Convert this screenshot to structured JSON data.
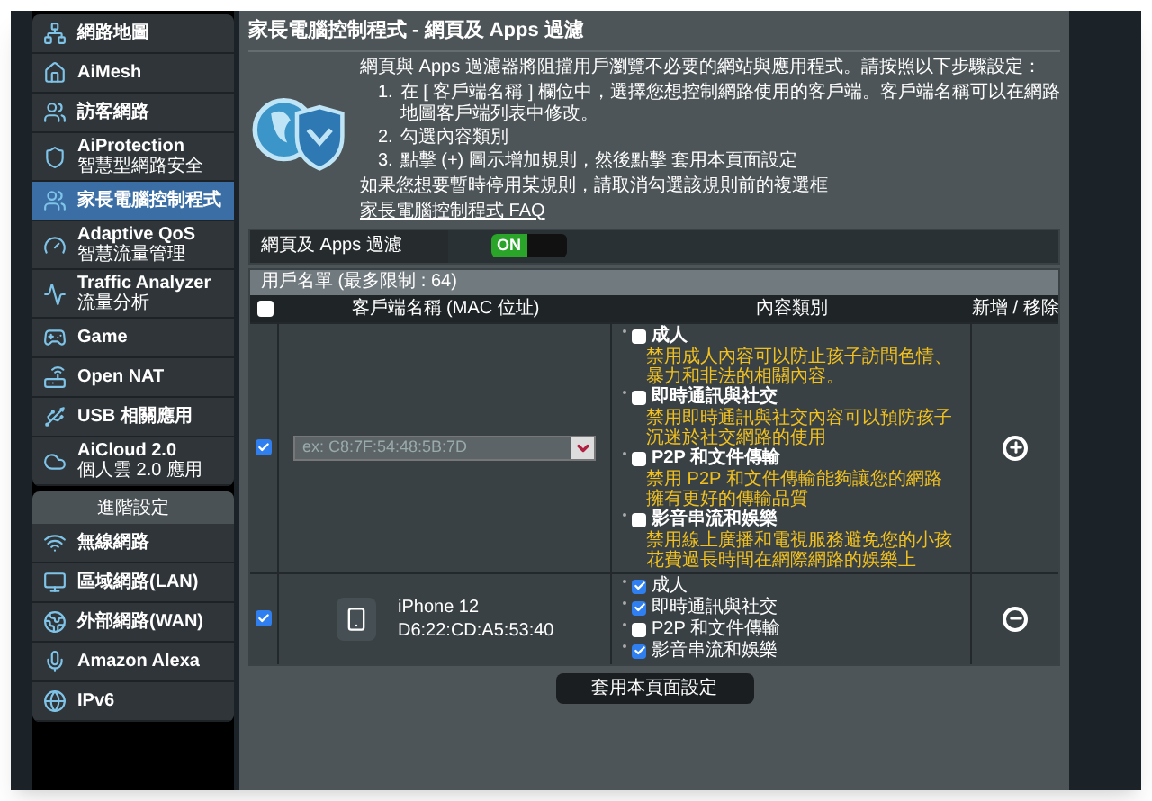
{
  "sidebar": {
    "items": [
      {
        "title": "網路地圖",
        "selected": false
      },
      {
        "title": "AiMesh",
        "selected": false
      },
      {
        "title": "訪客網路",
        "selected": false
      },
      {
        "title": "AiProtection",
        "subtitle": "智慧型網路安全",
        "selected": false
      },
      {
        "title": "家長電腦控制程式",
        "selected": true
      },
      {
        "title": "Adaptive QoS",
        "subtitle": "智慧流量管理",
        "selected": false
      },
      {
        "title": "Traffic Analyzer",
        "subtitle": "流量分析",
        "selected": false
      },
      {
        "title": "Game",
        "selected": false
      },
      {
        "title": "Open NAT",
        "selected": false
      },
      {
        "title": "USB 相關應用",
        "selected": false
      },
      {
        "title": "AiCloud 2.0",
        "subtitle": "個人雲 2.0 應用",
        "selected": false
      }
    ],
    "section_title": "進階設定",
    "advanced_items": [
      {
        "title": "無線網路",
        "selected": false
      },
      {
        "title": "區域網路(LAN)",
        "selected": false
      },
      {
        "title": "外部網路(WAN)",
        "selected": false
      },
      {
        "title": "Amazon Alexa",
        "selected": false
      },
      {
        "title": "IPv6",
        "selected": false
      }
    ]
  },
  "page": {
    "title": "家長電腦控制程式 - 網頁及 Apps 過濾",
    "intro": "網頁與 Apps 過濾器將阻擋用戶瀏覽不必要的網站與應用程式。請按照以下步驟設定：",
    "steps": [
      {
        "number": "1.",
        "text": "在 [ 客戶端名稱 ] 欄位中，選擇您想控制網路使用的客戶端。客戶端名稱可以在網路地圖客戶端列表中修改。"
      },
      {
        "number": "2.",
        "text": "勾選內容類別"
      },
      {
        "number": "3.",
        "text": "點擊 (+) 圖示增加規則，然後點擊 套用本頁面設定"
      }
    ],
    "note": "如果您想要暫時停用某規則，請取消勾選該規則前的複選框",
    "faq_link": "家長電腦控制程式 FAQ",
    "toggle": {
      "label": "網頁及 Apps 過濾",
      "on": true,
      "on_text": "ON"
    },
    "list_title": "用戶名單 (最多限制 : 64)",
    "columns": [
      "客戶端名稱 (MAC 位址)",
      "內容類別",
      "新增 / 移除"
    ],
    "select_all_checked": false,
    "rows": [
      {
        "kind": "new",
        "checked": true,
        "client": {
          "placeholder": "ex: C8:7F:54:48:5B:7D"
        },
        "categories": [
          {
            "label": "成人",
            "checked": false,
            "description": "禁用成人內容可以防止孩子訪問色情、暴力和非法的相關內容。"
          },
          {
            "label": "即時通訊與社交",
            "checked": false,
            "description": "禁用即時通訊與社交內容可以預防孩子沉迷於社交網路的使用"
          },
          {
            "label": "P2P 和文件傳輸",
            "checked": false,
            "description": "禁用 P2P 和文件傳輸能夠讓您的網路擁有更好的傳輸品質"
          },
          {
            "label": "影音串流和娛樂",
            "checked": false,
            "description": "禁用線上廣播和電視服務避免您的小孩花費過長時間在網際網路的娛樂上"
          }
        ]
      },
      {
        "kind": "device",
        "checked": true,
        "client": {
          "name": "iPhone 12",
          "mac": "D6:22:CD:A5:53:40"
        },
        "categories": [
          {
            "label": "成人",
            "checked": true
          },
          {
            "label": "即時通訊與社交",
            "checked": true
          },
          {
            "label": "P2P 和文件傳輸",
            "checked": false
          },
          {
            "label": "影音串流和娛樂",
            "checked": true
          }
        ]
      }
    ],
    "apply_button": "套用本頁面設定"
  }
}
